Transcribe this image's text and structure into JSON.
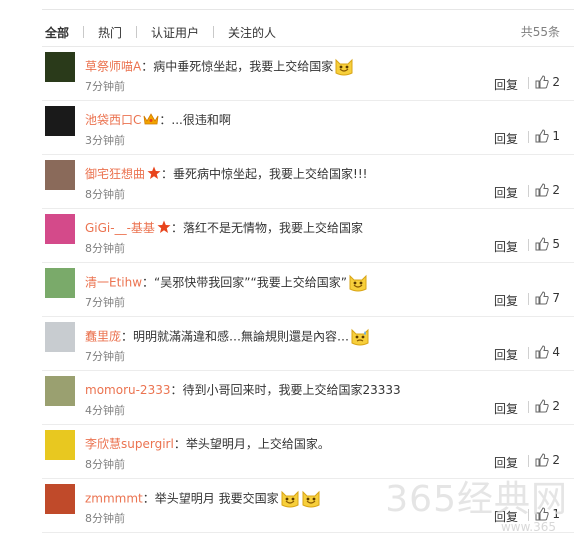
{
  "tabs": [
    "全部",
    "热门",
    "认证用户",
    "关注的人"
  ],
  "total": "共55条",
  "reply_label": "回复",
  "comments": [
    {
      "user": "草祭师喵A",
      "text": "：病中垂死惊坐起，我要上交给国家",
      "time": "7分钟前",
      "likes": "2",
      "badge": "",
      "emoji": [
        "smile-face"
      ],
      "avatar_color": "#2a3a1a"
    },
    {
      "user": "池袋西口C",
      "text": "：...很违和啊",
      "time": "3分钟前",
      "likes": "1",
      "badge": "crown",
      "emoji": [],
      "avatar_color": "#1a1a1a"
    },
    {
      "user": "御宅狂想曲",
      "text": "：垂死病中惊坐起，我要上交给国家!!!",
      "time": "8分钟前",
      "likes": "2",
      "badge": "star",
      "emoji": [],
      "avatar_color": "#8a6a5a"
    },
    {
      "user": "GiGi-__-基基",
      "text": "：落红不是无情物，我要上交给国家",
      "time": "8分钟前",
      "likes": "5",
      "badge": "star",
      "emoji": [],
      "avatar_color": "#d44a8a"
    },
    {
      "user": "清一Etihw",
      "text": "：“吴邪快带我回家”“我要上交给国家”",
      "time": "7分钟前",
      "likes": "7",
      "badge": "",
      "emoji": [
        "smile-face"
      ],
      "avatar_color": "#7aaa6a"
    },
    {
      "user": "蠢里庞",
      "text": "：明明就滿滿違和感…無論規則還是內容…",
      "time": "7分钟前",
      "likes": "4",
      "badge": "",
      "emoji": [
        "sweat-face"
      ],
      "avatar_color": "#c8ccd0"
    },
    {
      "user": "momoru-2333",
      "text": "：待到小哥回来时，我要上交给国家23333",
      "time": "4分钟前",
      "likes": "2",
      "badge": "",
      "emoji": [],
      "avatar_color": "#9aa070"
    },
    {
      "user": "李欣慧supergirl",
      "text": "：举头望明月，上交给国家。",
      "time": "8分钟前",
      "likes": "2",
      "badge": "",
      "emoji": [],
      "avatar_color": "#e8c820"
    },
    {
      "user": "zmmmmt",
      "text": "：举头望明月 我要交国家",
      "time": "8分钟前",
      "likes": "1",
      "badge": "",
      "emoji": [
        "smile-face",
        "smile-face"
      ],
      "avatar_color": "#c04a2a"
    }
  ],
  "watermark": "365经典网",
  "watermark_url": "www.365"
}
